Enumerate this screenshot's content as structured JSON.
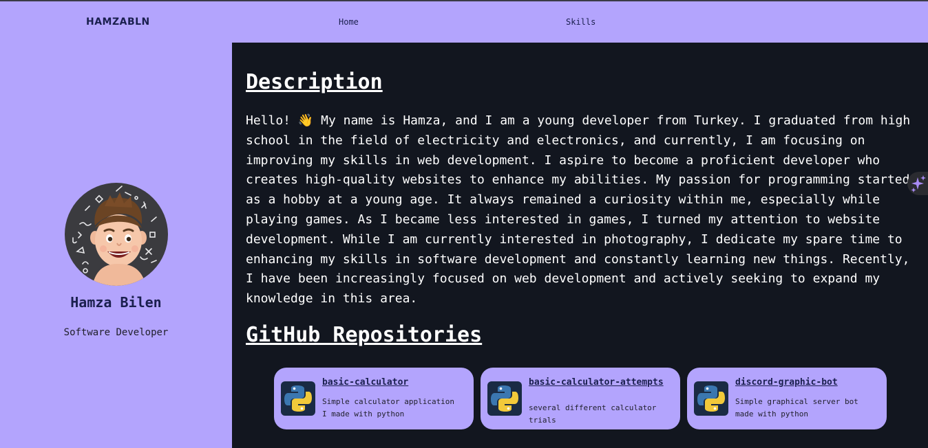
{
  "navbar": {
    "brand": "HAMZABLN",
    "links": [
      "Home",
      "Skills"
    ]
  },
  "profile": {
    "name": "Hamza Bilen",
    "role": "Software Developer"
  },
  "description": {
    "title": "Description",
    "text": "Hello! 👋 My name is Hamza, and I am a young developer from Turkey. I graduated from high school in the field of electricity and electronics, and currently, I am focusing on improving my skills in web development. I aspire to become a proficient developer who creates high-quality websites to enhance my abilities. My passion for programming started as a hobby at a young age. It always remained a curiosity within me, especially while playing games. As I became less interested in games, I turned my attention to website development. While I am currently interested in photography, I dedicate my spare time to enhancing my skills in software development and constantly learning new things. Recently, I have been increasingly focused on web development and actively seeking to expand my knowledge in this area."
  },
  "repositories": {
    "title": "GitHub Repositories",
    "items": [
      {
        "name": "basic-calculator",
        "description": "Simple calculator application I made with python",
        "icon": "python-icon"
      },
      {
        "name": "basic-calculator-attempts",
        "description": "several different calculator trials",
        "icon": "python-icon"
      },
      {
        "name": "discord-graphic-bot",
        "description": "Simple graphical server bot made with python",
        "icon": "python-icon"
      }
    ]
  },
  "widgets": {
    "assistant_icon": "sparkle-icon"
  },
  "colors": {
    "accent": "#b3a4fd",
    "main_background": "#12161f",
    "brand_text": "#1a1f4e"
  }
}
